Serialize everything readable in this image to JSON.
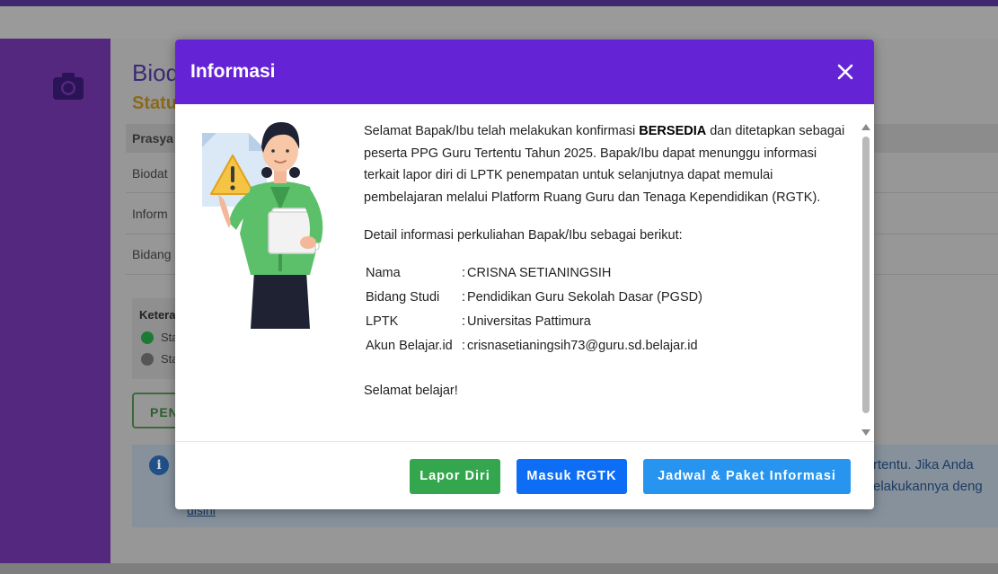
{
  "background": {
    "page_title": "Biod",
    "status_label": "Statu",
    "table_header": "Prasya",
    "rows": [
      "Biodat",
      "Inform",
      "Bidang"
    ],
    "keterangan": "Ketera",
    "status_items": [
      "Sta",
      "Sta"
    ],
    "pen_button": "PEN",
    "alert_line1": "rtentu. Jika Anda",
    "alert_line2": "elakukannya deng",
    "alert_link": "disini"
  },
  "modal": {
    "title": "Informasi",
    "intro_before": "Selamat Bapak/Ibu telah melakukan konfirmasi ",
    "intro_bold": "BERSEDIA",
    "intro_after": " dan ditetapkan sebagai peserta PPG Guru Tertentu Tahun 2025. Bapak/Ibu dapat menunggu informasi terkait lapor diri di LPTK penempatan untuk selanjutnya dapat memulai pembelajaran melalui Platform Ruang Guru dan Tenaga Kependidikan (RGTK).",
    "detail_intro": "Detail informasi perkuliahan Bapak/Ibu sebagai berikut:",
    "details": [
      {
        "label": "Nama",
        "value": "CRISNA SETIANINGSIH"
      },
      {
        "label": "Bidang Studi",
        "value": "Pendidikan Guru Sekolah Dasar (PGSD)"
      },
      {
        "label": "LPTK",
        "value": "Universitas Pattimura"
      },
      {
        "label": "Akun Belajar.id",
        "value": "crisnasetianingsih73@guru.sd.belajar.id"
      }
    ],
    "separator": ":",
    "closing": "Selamat belajar!",
    "buttons": {
      "lapor_diri": "Lapor Diri",
      "masuk_rgtk": "Masuk RGTK",
      "jadwal": "Jadwal & Paket Informasi"
    }
  },
  "colors": {
    "header": "#6424d6",
    "lapor": "#34a64d",
    "rgtk": "#0d6ef5",
    "jadwal": "#2795ef"
  }
}
